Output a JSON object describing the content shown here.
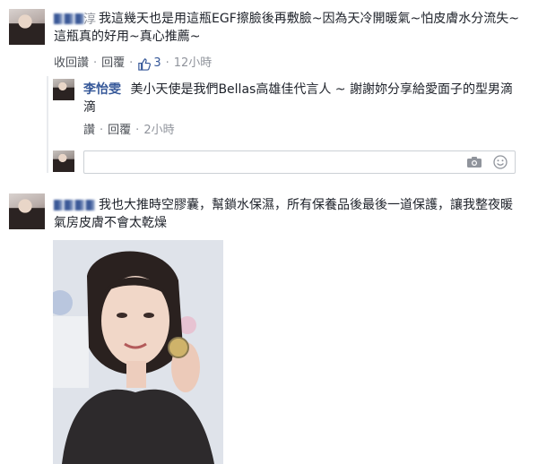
{
  "comment1": {
    "author_blurred_suffix": "淳",
    "text": "我這幾天也是用這瓶EGF擦臉後再敷臉~因為天冷開暖氣~怕皮膚水分流失~這瓶真的好用~真心推薦~",
    "actions": {
      "retract": "收回讚",
      "reply": "回覆",
      "like_count": "3",
      "time": "12小時"
    }
  },
  "reply1": {
    "author": "李怡雯",
    "text": "美小天使是我們Bellas高雄佳代言人 ~ 謝謝妳分享給愛面子的型男滴滴",
    "actions": {
      "like": "讚",
      "reply": "回覆",
      "time": "2小時"
    }
  },
  "reply_input": {
    "placeholder": "",
    "icons": [
      "camera-icon",
      "smiley-icon"
    ]
  },
  "comment2": {
    "text": "我也大推時空膠囊，幫鎖水保濕，所有保養品後最後一道保護，讓我整夜暖氣房皮膚不會太乾燥"
  },
  "colors": {
    "link": "#365899",
    "meta": "#90949c",
    "border": "#ccd0d5"
  }
}
